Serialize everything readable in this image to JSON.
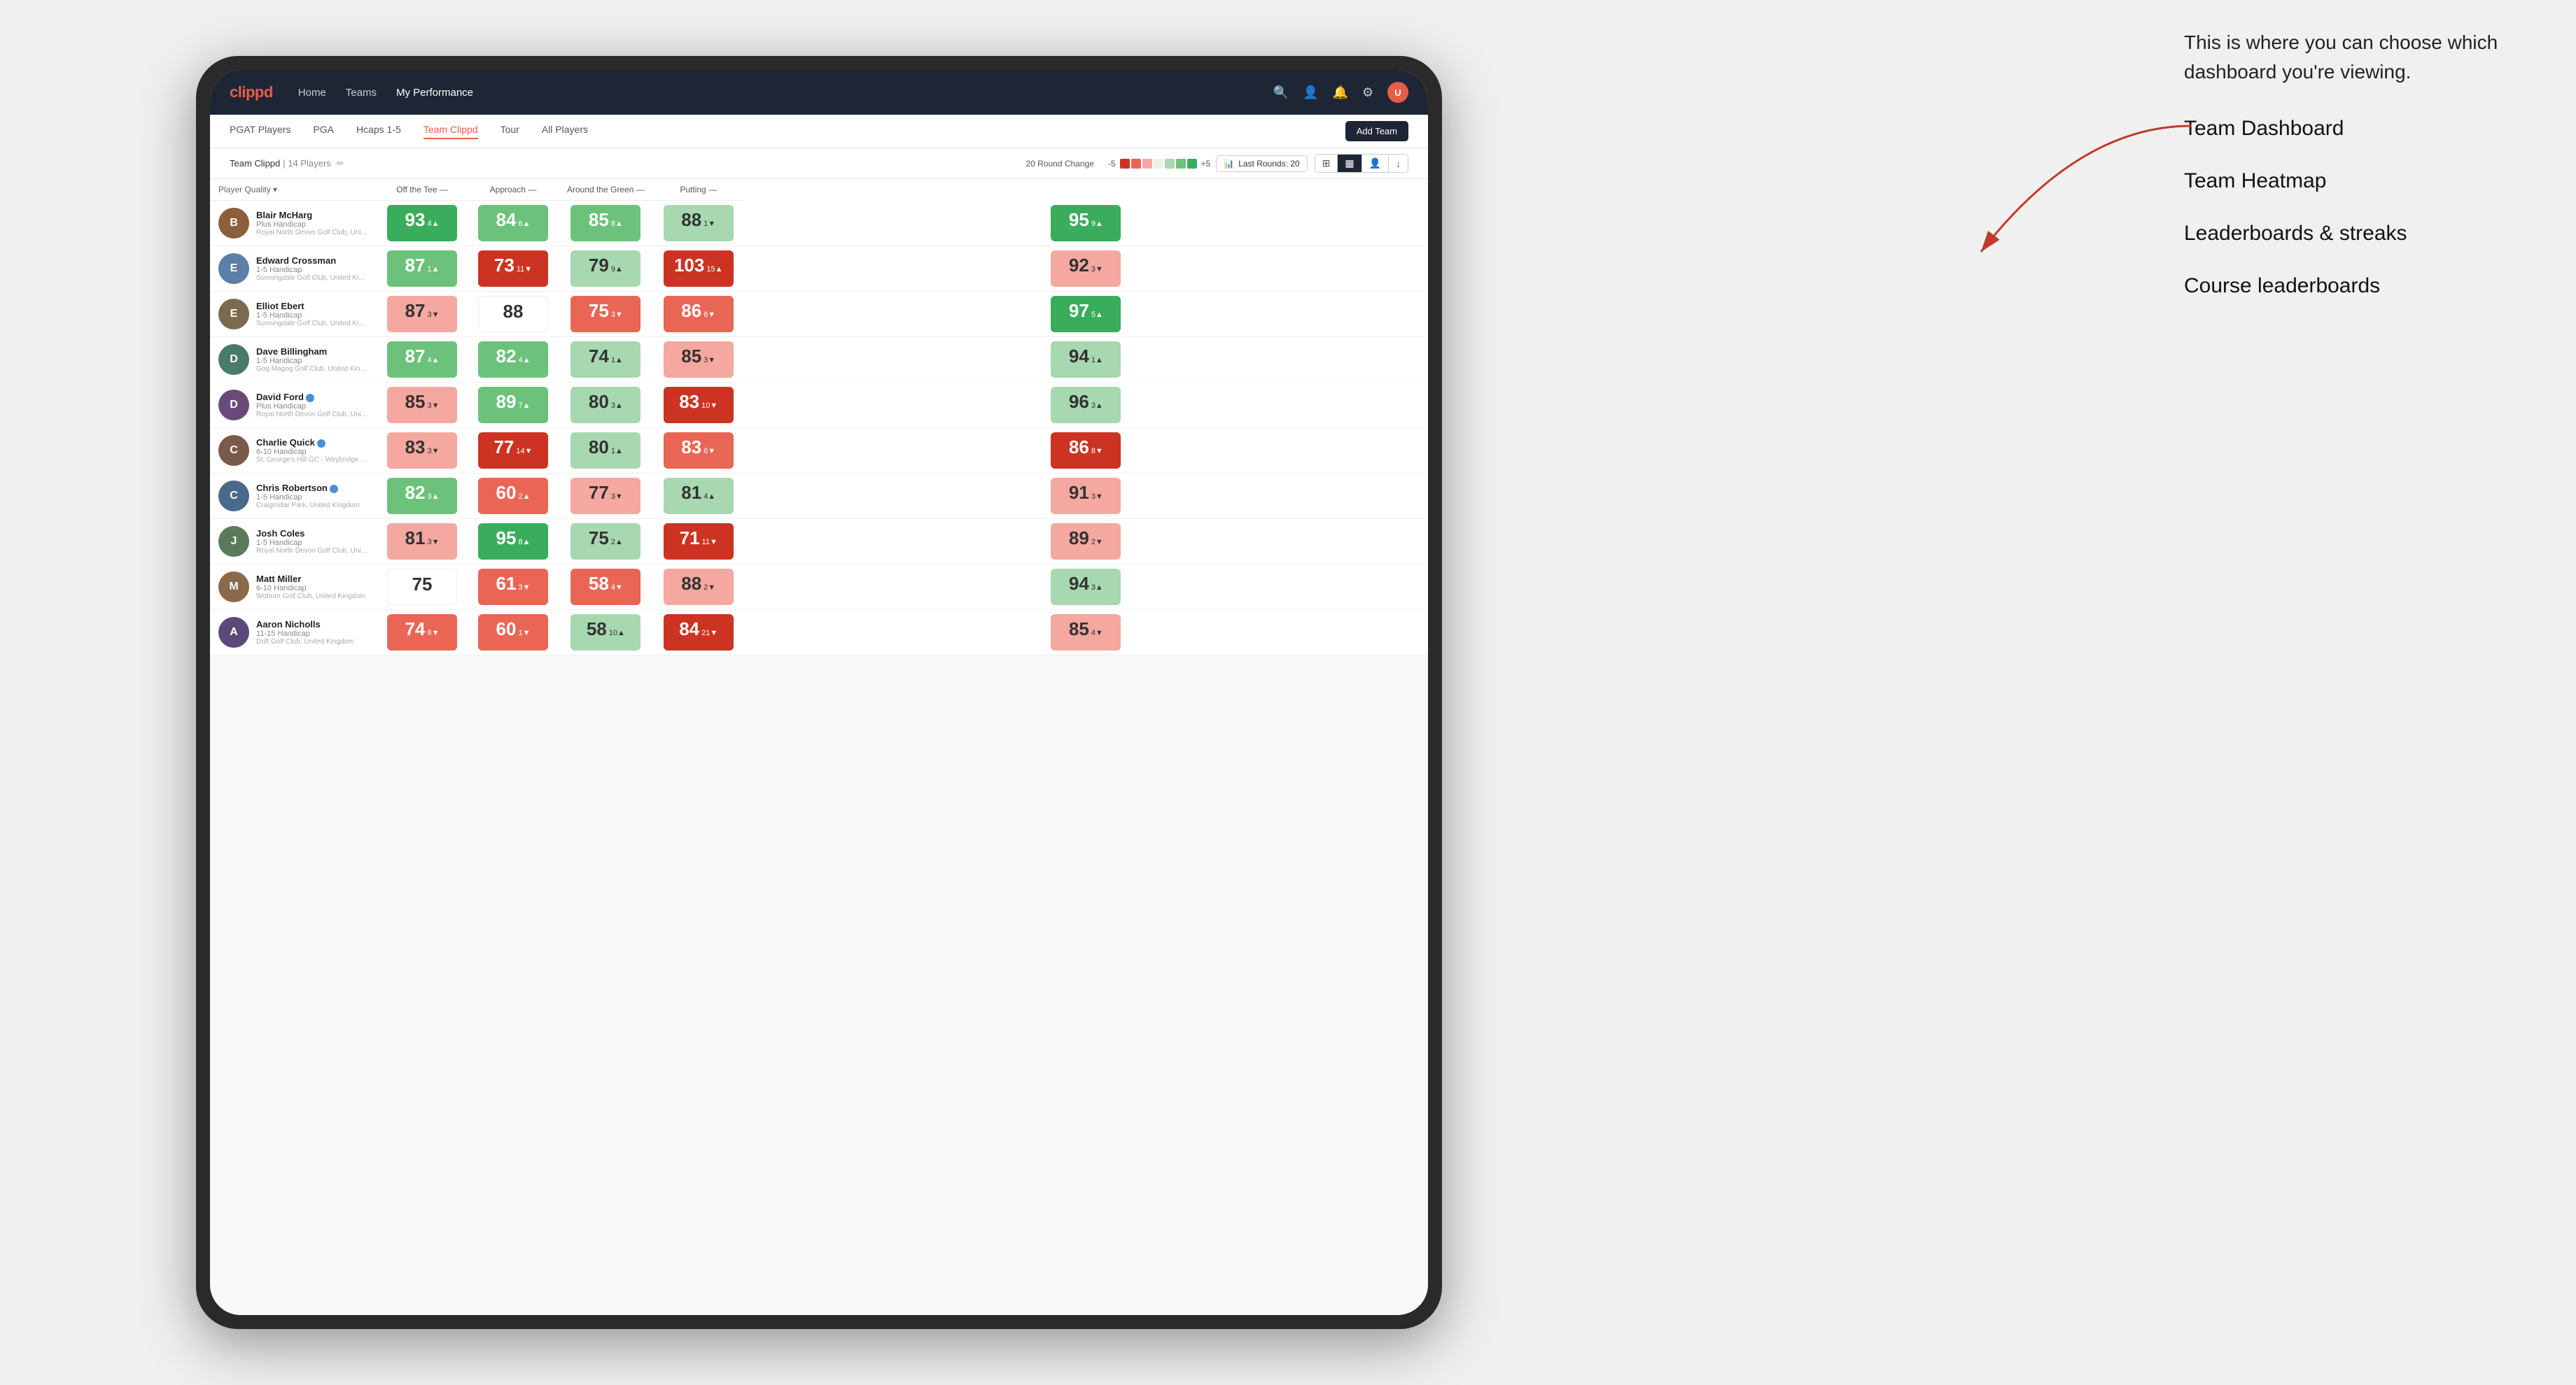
{
  "annotation": {
    "intro_text": "This is where you can choose which dashboard you're viewing.",
    "options": [
      "Team Dashboard",
      "Team Heatmap",
      "Leaderboards & streaks",
      "Course leaderboards"
    ]
  },
  "nav": {
    "logo": "clippd",
    "links": [
      "Home",
      "Teams",
      "My Performance"
    ],
    "active_link": "My Performance"
  },
  "sub_nav": {
    "links": [
      "PGAT Players",
      "PGA",
      "Hcaps 1-5",
      "Team Clippd",
      "Tour",
      "All Players"
    ],
    "active_link": "Team Clippd",
    "add_team_label": "Add Team"
  },
  "team_header": {
    "name": "Team Clippd",
    "separator": "|",
    "count": "14 Players",
    "round_change_label": "20 Round Change",
    "scale_low": "-5",
    "scale_high": "+5",
    "last_rounds_label": "Last Rounds:",
    "last_rounds_value": "20"
  },
  "table": {
    "columns": {
      "player": "Player Quality",
      "categories": [
        "Off the Tee",
        "Approach",
        "Around the Green",
        "Putting"
      ]
    },
    "rows": [
      {
        "name": "Blair McHarg",
        "hcap": "Plus Handicap",
        "club": "Royal North Devon Golf Club, United Kingdom",
        "scores": [
          {
            "value": 93,
            "delta": "4",
            "dir": "up",
            "color": "green-strong"
          },
          {
            "value": 84,
            "delta": "6",
            "dir": "up",
            "color": "green-medium"
          },
          {
            "value": 85,
            "delta": "8",
            "dir": "up",
            "color": "green-medium"
          },
          {
            "value": 88,
            "delta": "1",
            "dir": "down",
            "color": "green-light"
          },
          {
            "value": 95,
            "delta": "9",
            "dir": "up",
            "color": "green-strong"
          }
        ]
      },
      {
        "name": "Edward Crossman",
        "hcap": "1-5 Handicap",
        "club": "Sunningdale Golf Club, United Kingdom",
        "scores": [
          {
            "value": 87,
            "delta": "1",
            "dir": "up",
            "color": "green-medium"
          },
          {
            "value": 73,
            "delta": "11",
            "dir": "down",
            "color": "red-strong"
          },
          {
            "value": 79,
            "delta": "9",
            "dir": "up",
            "color": "green-light"
          },
          {
            "value": 103,
            "delta": "15",
            "dir": "up",
            "color": "red-strong"
          },
          {
            "value": 92,
            "delta": "3",
            "dir": "down",
            "color": "red-light"
          }
        ]
      },
      {
        "name": "Elliot Ebert",
        "hcap": "1-5 Handicap",
        "club": "Sunningdale Golf Club, United Kingdom",
        "scores": [
          {
            "value": 87,
            "delta": "3",
            "dir": "down",
            "color": "red-light"
          },
          {
            "value": 88,
            "delta": "",
            "dir": "",
            "color": "neutral"
          },
          {
            "value": 75,
            "delta": "3",
            "dir": "down",
            "color": "red-medium"
          },
          {
            "value": 86,
            "delta": "6",
            "dir": "down",
            "color": "red-medium"
          },
          {
            "value": 97,
            "delta": "5",
            "dir": "up",
            "color": "green-strong"
          }
        ]
      },
      {
        "name": "Dave Billingham",
        "hcap": "1-5 Handicap",
        "club": "Gog Magog Golf Club, United Kingdom",
        "scores": [
          {
            "value": 87,
            "delta": "4",
            "dir": "up",
            "color": "green-medium"
          },
          {
            "value": 82,
            "delta": "4",
            "dir": "up",
            "color": "green-medium"
          },
          {
            "value": 74,
            "delta": "1",
            "dir": "up",
            "color": "green-light"
          },
          {
            "value": 85,
            "delta": "3",
            "dir": "down",
            "color": "red-light"
          },
          {
            "value": 94,
            "delta": "1",
            "dir": "up",
            "color": "green-light"
          }
        ]
      },
      {
        "name": "David Ford",
        "hcap": "Plus Handicap",
        "club": "Royal North Devon Golf Club, United Kingdom",
        "verified": true,
        "scores": [
          {
            "value": 85,
            "delta": "3",
            "dir": "down",
            "color": "red-light"
          },
          {
            "value": 89,
            "delta": "7",
            "dir": "up",
            "color": "green-medium"
          },
          {
            "value": 80,
            "delta": "3",
            "dir": "up",
            "color": "green-light"
          },
          {
            "value": 83,
            "delta": "10",
            "dir": "down",
            "color": "red-strong"
          },
          {
            "value": 96,
            "delta": "3",
            "dir": "up",
            "color": "green-light"
          }
        ]
      },
      {
        "name": "Charlie Quick",
        "hcap": "6-10 Handicap",
        "club": "St. George's Hill GC - Weybridge - Surrey, Uni...",
        "verified": true,
        "scores": [
          {
            "value": 83,
            "delta": "3",
            "dir": "down",
            "color": "red-light"
          },
          {
            "value": 77,
            "delta": "14",
            "dir": "down",
            "color": "red-strong"
          },
          {
            "value": 80,
            "delta": "1",
            "dir": "up",
            "color": "green-light"
          },
          {
            "value": 83,
            "delta": "6",
            "dir": "down",
            "color": "red-medium"
          },
          {
            "value": 86,
            "delta": "8",
            "dir": "down",
            "color": "red-strong"
          }
        ]
      },
      {
        "name": "Chris Robertson",
        "hcap": "1-5 Handicap",
        "club": "Craigmillar Park, United Kingdom",
        "verified": true,
        "scores": [
          {
            "value": 82,
            "delta": "3",
            "dir": "up",
            "color": "green-medium"
          },
          {
            "value": 60,
            "delta": "2",
            "dir": "up",
            "color": "red-medium"
          },
          {
            "value": 77,
            "delta": "3",
            "dir": "down",
            "color": "red-light"
          },
          {
            "value": 81,
            "delta": "4",
            "dir": "up",
            "color": "green-light"
          },
          {
            "value": 91,
            "delta": "3",
            "dir": "down",
            "color": "red-light"
          }
        ]
      },
      {
        "name": "Josh Coles",
        "hcap": "1-5 Handicap",
        "club": "Royal North Devon Golf Club, United Kingdom",
        "scores": [
          {
            "value": 81,
            "delta": "3",
            "dir": "down",
            "color": "red-light"
          },
          {
            "value": 95,
            "delta": "8",
            "dir": "up",
            "color": "green-strong"
          },
          {
            "value": 75,
            "delta": "2",
            "dir": "up",
            "color": "green-light"
          },
          {
            "value": 71,
            "delta": "11",
            "dir": "down",
            "color": "red-strong"
          },
          {
            "value": 89,
            "delta": "2",
            "dir": "down",
            "color": "red-light"
          }
        ]
      },
      {
        "name": "Matt Miller",
        "hcap": "6-10 Handicap",
        "club": "Woburn Golf Club, United Kingdom",
        "scores": [
          {
            "value": 75,
            "delta": "",
            "dir": "",
            "color": "neutral"
          },
          {
            "value": 61,
            "delta": "3",
            "dir": "down",
            "color": "red-medium"
          },
          {
            "value": 58,
            "delta": "4",
            "dir": "down",
            "color": "red-medium"
          },
          {
            "value": 88,
            "delta": "2",
            "dir": "down",
            "color": "red-light"
          },
          {
            "value": 94,
            "delta": "3",
            "dir": "up",
            "color": "green-light"
          }
        ]
      },
      {
        "name": "Aaron Nicholls",
        "hcap": "11-15 Handicap",
        "club": "Drift Golf Club, United Kingdom",
        "scores": [
          {
            "value": 74,
            "delta": "8",
            "dir": "down",
            "color": "red-medium"
          },
          {
            "value": 60,
            "delta": "1",
            "dir": "down",
            "color": "red-medium"
          },
          {
            "value": 58,
            "delta": "10",
            "dir": "up",
            "color": "green-light"
          },
          {
            "value": 84,
            "delta": "21",
            "dir": "down",
            "color": "red-strong"
          },
          {
            "value": 85,
            "delta": "4",
            "dir": "down",
            "color": "red-light"
          }
        ]
      }
    ]
  },
  "icons": {
    "search": "🔍",
    "user": "👤",
    "bell": "🔔",
    "grid": "⊞",
    "settings": "⚙",
    "heatmap": "▦",
    "list": "≡",
    "edit": "✏"
  }
}
